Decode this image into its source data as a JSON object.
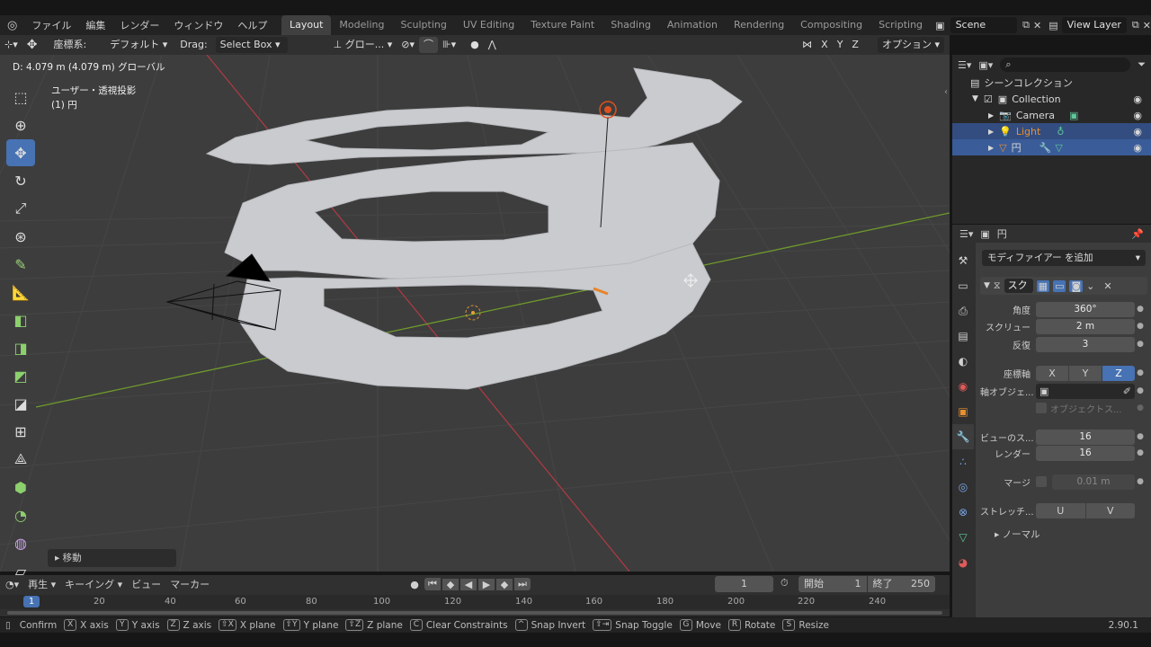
{
  "menubar": {
    "items": [
      "ファイル",
      "編集",
      "レンダー",
      "ウィンドウ",
      "ヘルプ"
    ],
    "workspaces": [
      "Layout",
      "Modeling",
      "Sculpting",
      "UV Editing",
      "Texture Paint",
      "Shading",
      "Animation",
      "Rendering",
      "Compositing",
      "Scripting"
    ],
    "active_workspace": "Layout",
    "scene": "Scene",
    "view_layer": "View Layer"
  },
  "viewport_header": {
    "coord_label": "座標系:",
    "orientation": "デフォルト",
    "drag_label": "Drag:",
    "drag_mode": "Select Box",
    "transform_orientation": "グロー...",
    "axes": [
      "X",
      "Y",
      "Z"
    ],
    "options": "オプション"
  },
  "viewport": {
    "info_line": "D: 4.079 m (4.079 m) グローバル",
    "view_name": "ユーザー・透視投影",
    "object_name": "(1) 円",
    "last_op_panel": "移動"
  },
  "outliner": {
    "root": "シーンコレクション",
    "items": [
      {
        "name": "Collection",
        "color": "#d0d0d0"
      },
      {
        "name": "Camera",
        "color": "#d0d0d0"
      },
      {
        "name": "Light",
        "color": "#e8902e"
      },
      {
        "name": "円",
        "color": "#e0e0e0"
      }
    ]
  },
  "properties": {
    "object_name": "円",
    "add_modifier": "モディファイアー を追加",
    "modifier_name": "スク",
    "fields": [
      {
        "label": "角度",
        "value": "360°"
      },
      {
        "label": "スクリュー",
        "value": "2 m"
      },
      {
        "label": "反復",
        "value": "3"
      }
    ],
    "axis_label": "座標軸",
    "axis_options": [
      "X",
      "Y",
      "Z"
    ],
    "axis_active": "Z",
    "axis_object_label": "軸オブジェ...",
    "object_screw_label": "オブジェクトス...",
    "steps": [
      {
        "label": "ビューのス...",
        "value": "16"
      },
      {
        "label": "レンダー",
        "value": "16"
      }
    ],
    "merge_label": "マージ",
    "merge_value": "0.01 m",
    "stretch_label": "ストレッチ...",
    "stretch_options": [
      "U",
      "V"
    ],
    "normals_label": "ノーマル"
  },
  "timeline": {
    "menus": [
      "再生",
      "キーイング",
      "ビュー",
      "マーカー"
    ],
    "current_frame": "1",
    "start_label": "開始",
    "start": "1",
    "end_label": "終了",
    "end": "250",
    "ruler": [
      "1",
      "20",
      "40",
      "60",
      "80",
      "100",
      "120",
      "140",
      "160",
      "180",
      "200",
      "220",
      "240"
    ]
  },
  "statusbar": {
    "hints": [
      {
        "key": "",
        "label": "Confirm"
      },
      {
        "key": "X",
        "label": "X axis"
      },
      {
        "key": "Y",
        "label": "Y axis"
      },
      {
        "key": "Z",
        "label": "Z axis"
      },
      {
        "key": "⇧X",
        "label": "X plane"
      },
      {
        "key": "⇧Y",
        "label": "Y plane"
      },
      {
        "key": "⇧Z",
        "label": "Z plane"
      },
      {
        "key": "C",
        "label": "Clear Constraints"
      },
      {
        "key": "^",
        "label": "Snap Invert"
      },
      {
        "key": "⇧⇥",
        "label": "Snap Toggle"
      },
      {
        "key": "G",
        "label": "Move"
      },
      {
        "key": "R",
        "label": "Rotate"
      },
      {
        "key": "S",
        "label": "Resize"
      }
    ],
    "version": "2.90.1"
  },
  "colors": {
    "accent": "#4772b3",
    "x_axis": "#b33a45",
    "y_axis": "#6f9a2c",
    "mesh": "#c9cbcf",
    "selection": "#334d80"
  }
}
